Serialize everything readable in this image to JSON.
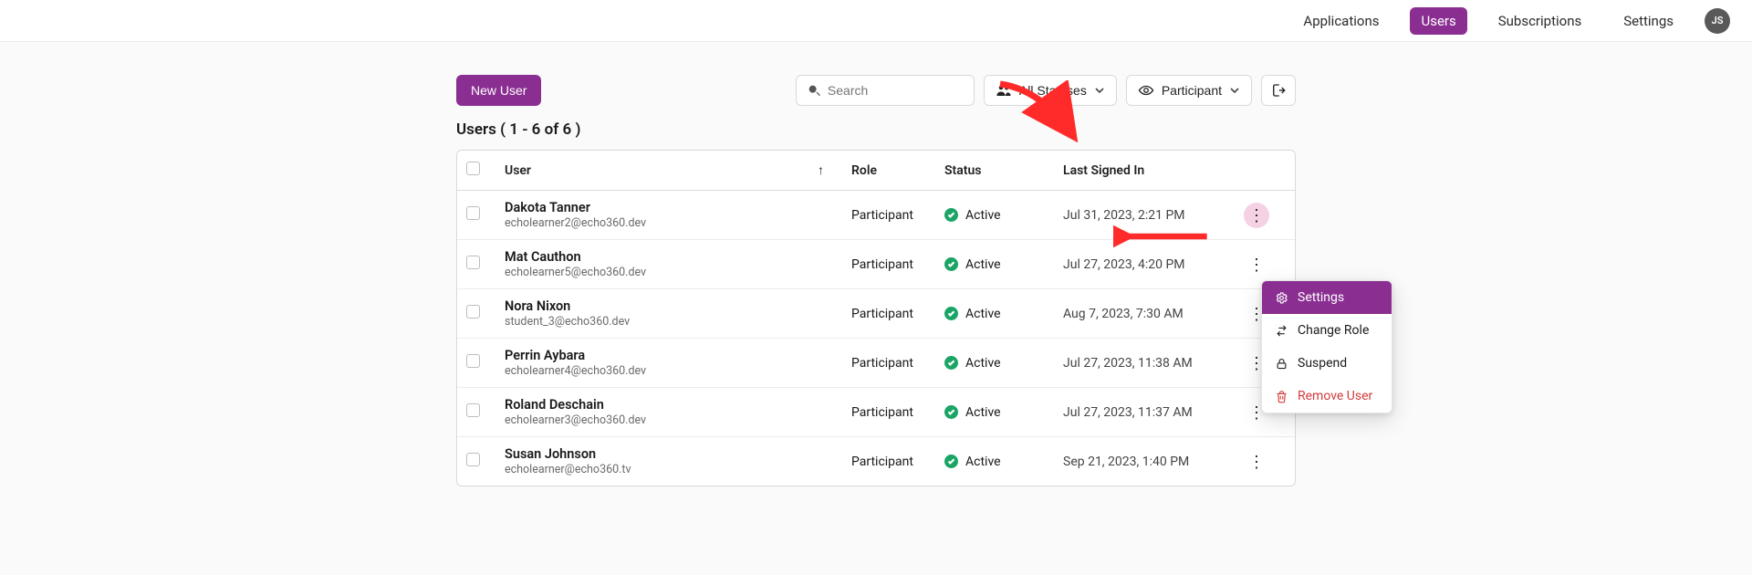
{
  "nav": {
    "items": [
      {
        "label": "Applications",
        "active": false
      },
      {
        "label": "Users",
        "active": true
      },
      {
        "label": "Subscriptions",
        "active": false
      },
      {
        "label": "Settings",
        "active": false
      }
    ],
    "avatar_initials": "JS"
  },
  "toolbar": {
    "new_user_label": "New User",
    "search_placeholder": "Search",
    "status_filter_label": "All Statuses",
    "role_filter_label": "Participant"
  },
  "count_line_prefix": "Users ( ",
  "count_line_range": "1 - 6 of 6",
  "count_line_suffix": " )",
  "columns": {
    "user": "User",
    "role": "Role",
    "status": "Status",
    "last": "Last Signed In",
    "sort_indicator": "↑"
  },
  "rows": [
    {
      "name": "Dakota Tanner",
      "email": "echolearner2@echo360.dev",
      "role": "Participant",
      "status": "Active",
      "last": "Jul 31, 2023, 2:21 PM",
      "menu_open": true
    },
    {
      "name": "Mat Cauthon",
      "email": "echolearner5@echo360.dev",
      "role": "Participant",
      "status": "Active",
      "last": "Jul 27, 2023, 4:20 PM",
      "menu_open": false
    },
    {
      "name": "Nora Nixon",
      "email": "student_3@echo360.dev",
      "role": "Participant",
      "status": "Active",
      "last": "Aug 7, 2023, 7:30 AM",
      "menu_open": false
    },
    {
      "name": "Perrin Aybara",
      "email": "echolearner4@echo360.dev",
      "role": "Participant",
      "status": "Active",
      "last": "Jul 27, 2023, 11:38 AM",
      "menu_open": false
    },
    {
      "name": "Roland Deschain",
      "email": "echolearner3@echo360.dev",
      "role": "Participant",
      "status": "Active",
      "last": "Jul 27, 2023, 11:37 AM",
      "menu_open": false
    },
    {
      "name": "Susan Johnson",
      "email": "echolearner@echo360.tv",
      "role": "Participant",
      "status": "Active",
      "last": "Sep 21, 2023, 1:40 PM",
      "menu_open": false
    }
  ],
  "menu": {
    "settings": "Settings",
    "change_role": "Change Role",
    "suspend": "Suspend",
    "remove": "Remove User"
  }
}
